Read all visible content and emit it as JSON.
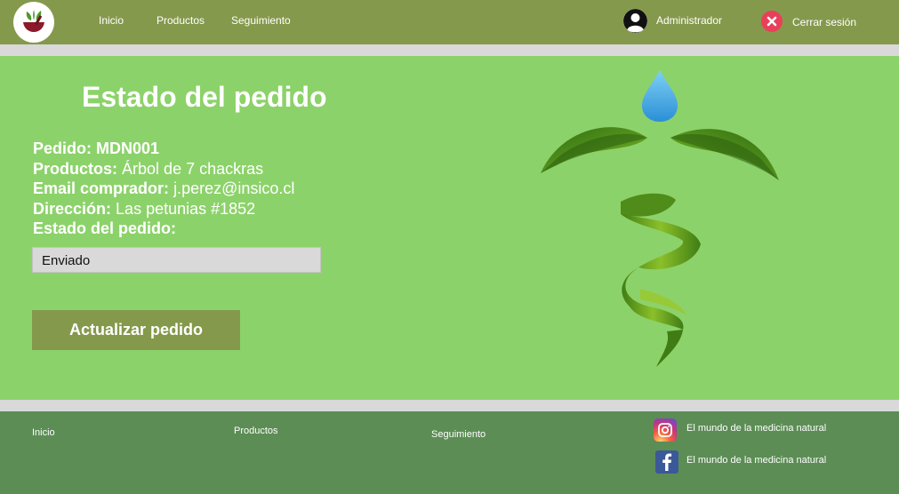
{
  "colors": {
    "header": "#85994d",
    "main": "#8cd26a",
    "footer": "#5c8d55",
    "divider": "#d9d9d9",
    "logout": "#e8405a"
  },
  "header": {
    "logo_icon": "herbal-mortar-logo-icon",
    "nav": [
      "Inicio",
      "Productos",
      "Seguimiento"
    ],
    "user_icon": "user-avatar-icon",
    "user_name": "Administrador",
    "logout_icon": "close-circle-icon",
    "logout_label": "Cerrar sesión"
  },
  "main": {
    "title": "Estado del pedido",
    "fields": [
      {
        "label": "Pedido:",
        "value": "MDN001"
      },
      {
        "label": "Productos:",
        "value": "Árbol de 7 chackras"
      },
      {
        "label": "Email comprador:",
        "value": "j.perez@insico.cl"
      },
      {
        "label": "Dirección:",
        "value": "Las petunias #1852"
      },
      {
        "label": "Estado del pedido:",
        "value": ""
      }
    ],
    "status_selected": "Enviado",
    "update_label": "Actualizar pedido",
    "emblem_icon": "leaf-caduceus-icon"
  },
  "footer": {
    "links": [
      "Inicio",
      "Productos",
      "Seguimiento"
    ],
    "social": [
      {
        "icon": "instagram-icon",
        "label": "El mundo de la medicina natural"
      },
      {
        "icon": "facebook-icon",
        "label": "El mundo de la medicina natural"
      }
    ]
  }
}
